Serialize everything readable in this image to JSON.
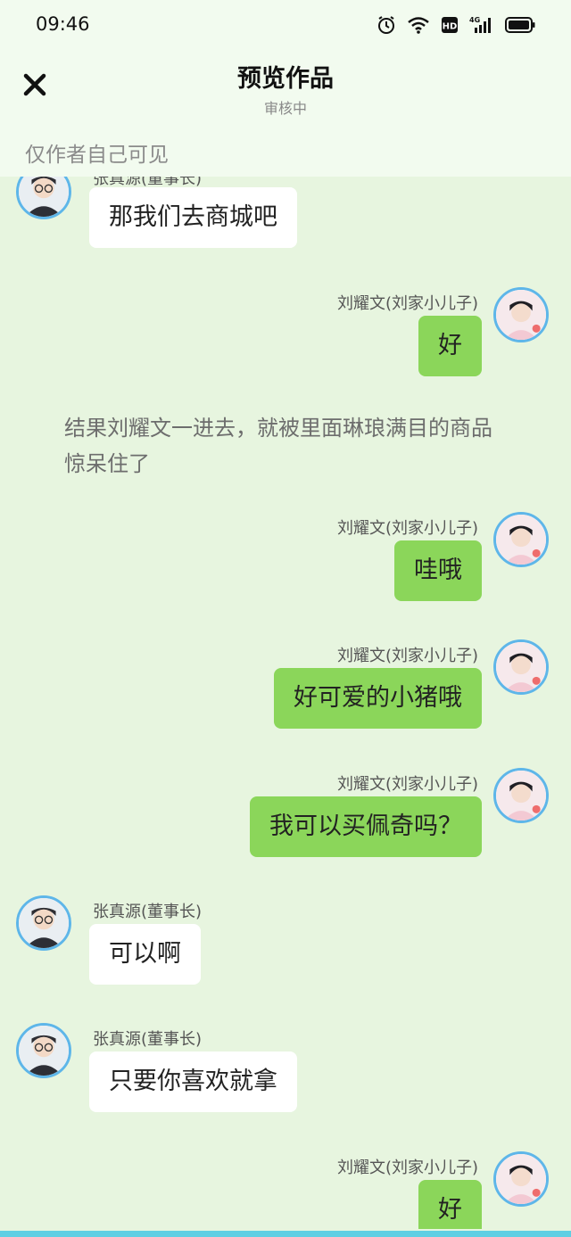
{
  "status": {
    "time": "09:46"
  },
  "header": {
    "title": "预览作品",
    "subtitle": "审核中"
  },
  "notice": {
    "text": "仅作者自己可见"
  },
  "chat": {
    "messages": [
      {
        "side": "left",
        "name": "张真源(董事长)",
        "text": "那我们去商城吧"
      },
      {
        "side": "right",
        "name": "刘耀文(刘家小儿子)",
        "text": "好"
      },
      {
        "side": "narration",
        "text": "结果刘耀文一进去，就被里面琳琅满目的商品惊呆住了"
      },
      {
        "side": "right",
        "name": "刘耀文(刘家小儿子)",
        "text": "哇哦"
      },
      {
        "side": "right",
        "name": "刘耀文(刘家小儿子)",
        "text": "好可爱的小猪哦"
      },
      {
        "side": "right",
        "name": "刘耀文(刘家小儿子)",
        "text": "我可以买佩奇吗？"
      },
      {
        "side": "left",
        "name": "张真源(董事长)",
        "text": "可以啊"
      },
      {
        "side": "left",
        "name": "张真源(董事长)",
        "text": "只要你喜欢就拿"
      },
      {
        "side": "right",
        "name": "刘耀文(刘家小儿子)",
        "text": "好"
      }
    ]
  },
  "icons": {
    "close": "close-icon",
    "alarm": "alarm-icon",
    "wifi": "wifi-icon",
    "hd": "hd-icon",
    "signal": "signal-4g-icon",
    "battery": "battery-icon",
    "avatar_left": "avatar-zhang",
    "avatar_right": "avatar-liu"
  },
  "colors": {
    "background": "#e7f5df",
    "header_bg": "#f2fbef",
    "bubble_right": "#8bd65a",
    "bubble_left": "#ffffff",
    "avatar_ring": "#5eb6e9"
  }
}
